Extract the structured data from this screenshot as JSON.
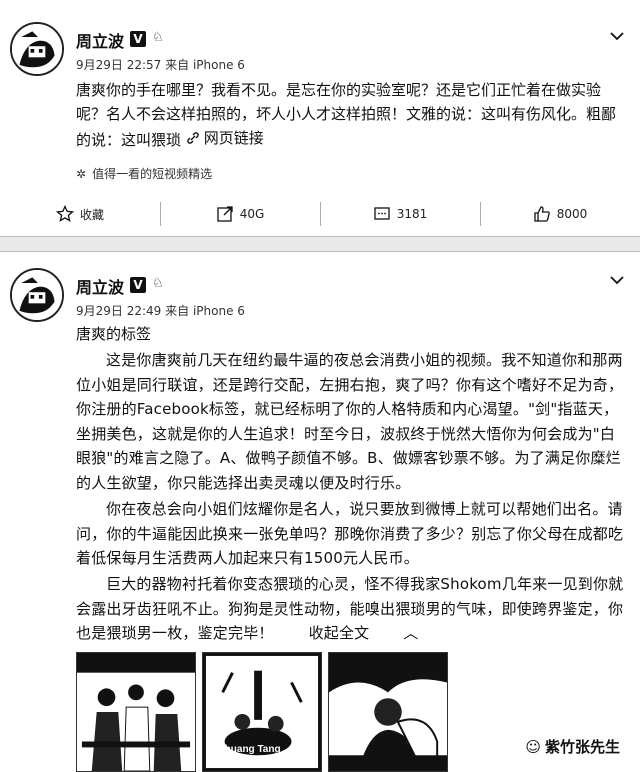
{
  "post1": {
    "author": "周立波",
    "verified_badge": "V",
    "time": "9月29日 22:57",
    "source": "来自 iPhone 6",
    "text": "唐爽你的手在哪里？我看不见。是忘在你的实验室呢？还是它们正忙着在做实验呢？名人不会这样拍照的，坏人小人才这样拍照！文雅的说：这叫有伤风化。粗鄙的说：这叫猥琐",
    "link_label": "网页链接",
    "rec_text": "值得一看的短视频精选",
    "actions": {
      "fav": "收藏",
      "repost": "40G",
      "comment": "3181",
      "like": "8000"
    }
  },
  "post2": {
    "author": "周立波",
    "verified_badge": "V",
    "time": "9月29日 22:49",
    "source": "来自 iPhone 6",
    "title": "唐爽的标签",
    "p1": "这是你唐爽前几天在纽约最牛逼的夜总会消费小姐的视频。我不知道你和那两位小姐是同行联谊，还是跨行交配，左拥右抱，爽了吗？你有这个嗜好不足为奇，你注册的Facebook标签，就已经标明了你的人格特质和内心渴望。\"剑\"指蓝天，坐拥美色，这就是你的人生追求！时至今日，波叔终于恍然大悟你为何会成为\"白眼狼\"的难言之隐了。A、做鸭子颜值不够。B、做嫖客钞票不够。为了满足你糜烂的人生欲望，你只能选择出卖灵魂以便及时行乐。",
    "p2": "你在夜总会向小姐们炫耀你是名人，说只要放到微博上就可以帮她们出名。请问，你的牛逼能因此换来一张免单吗？那晚你消费了多少？别忘了你父母在成都吃着低保每月生活费两人加起来只有1500元人民币。",
    "p3": "巨大的器物衬托着你变态猥琐的心灵，怪不得我家Shokom几年来一见到你就会露出牙齿狂吼不止。狗狗是灵性动物，能嗅出猥琐男的气味，即使跨界鉴定，你也是猥琐男一枚，鉴定完毕！",
    "collapse": "收起全文",
    "thumb2_caption": "Shuang Tang"
  },
  "watermark": "紫竹张先生",
  "icons": {
    "fav": "star-icon",
    "repost": "repost-icon",
    "comment": "comment-icon",
    "like": "thumbs-up-icon"
  }
}
